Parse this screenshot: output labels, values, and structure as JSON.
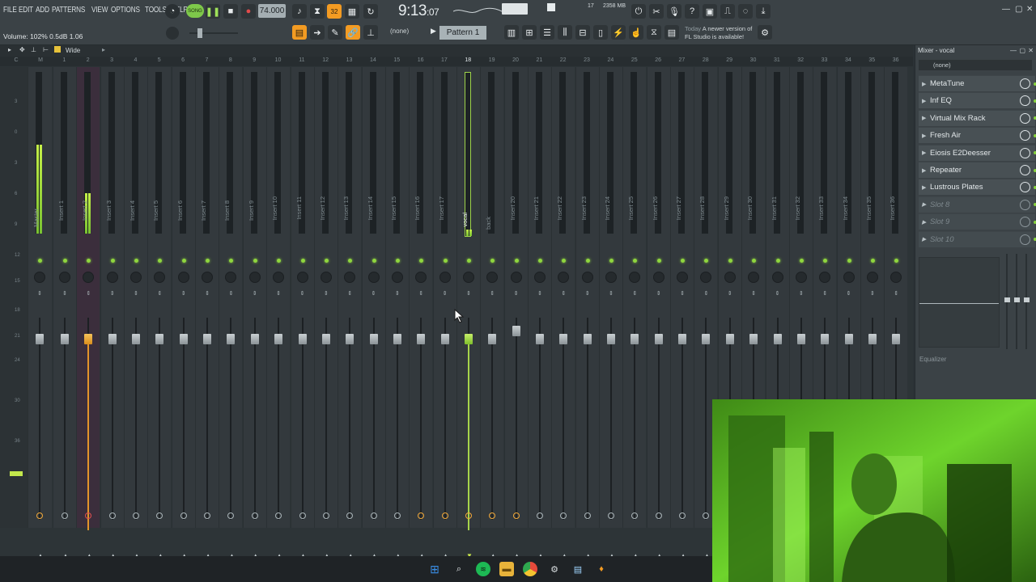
{
  "menu": [
    "FILE",
    "EDIT",
    "ADD",
    "PATTERNS",
    "VIEW",
    "OPTIONS",
    "TOOLS",
    "HELP"
  ],
  "transport": {
    "song_label": "SONG",
    "tempo": "74.000",
    "time": "9:13",
    "time_sub": ":07"
  },
  "hint_bar": "Volume: 102%  0.5dB  1.06",
  "pattern": {
    "selected": "Pattern 1",
    "picker": "(none)"
  },
  "cpu": "17",
  "memory": "2358 MB",
  "news": {
    "day": "Today",
    "line1": "A newer version of",
    "line2": "FL Studio is available!"
  },
  "mixer": {
    "view_label": "Wide",
    "selected_index": 18,
    "strips": [
      {
        "name": "Master",
        "level": 0.55
      },
      {
        "name": "Insert 1",
        "level": 0
      },
      {
        "name": "Insert 2",
        "level": 0.25
      },
      {
        "name": "Insert 3",
        "level": 0
      },
      {
        "name": "Insert 4",
        "level": 0
      },
      {
        "name": "Insert 5",
        "level": 0
      },
      {
        "name": "Insert 6",
        "level": 0
      },
      {
        "name": "Insert 7",
        "level": 0
      },
      {
        "name": "Insert 8",
        "level": 0
      },
      {
        "name": "Insert 9",
        "level": 0
      },
      {
        "name": "Insert 10",
        "level": 0
      },
      {
        "name": "Insert 11",
        "level": 0
      },
      {
        "name": "Insert 12",
        "level": 0
      },
      {
        "name": "Insert 13",
        "level": 0
      },
      {
        "name": "Insert 14",
        "level": 0
      },
      {
        "name": "Insert 15",
        "level": 0
      },
      {
        "name": "Insert 16",
        "level": 0
      },
      {
        "name": "Insert 17",
        "level": 0
      },
      {
        "name": "vocal",
        "level": 0.04
      },
      {
        "name": "back",
        "level": 0
      },
      {
        "name": "Insert 20",
        "level": 0
      },
      {
        "name": "Insert 21",
        "level": 0
      },
      {
        "name": "Insert 22",
        "level": 0
      },
      {
        "name": "Insert 23",
        "level": 0
      },
      {
        "name": "Insert 24",
        "level": 0
      },
      {
        "name": "Insert 25",
        "level": 0
      },
      {
        "name": "Insert 26",
        "level": 0
      },
      {
        "name": "Insert 27",
        "level": 0
      },
      {
        "name": "Insert 28",
        "level": 0
      },
      {
        "name": "Insert 29",
        "level": 0
      },
      {
        "name": "Insert 30",
        "level": 0
      },
      {
        "name": "Insert 31",
        "level": 0
      },
      {
        "name": "Insert 32",
        "level": 0
      },
      {
        "name": "Insert 33",
        "level": 0
      },
      {
        "name": "Insert 34",
        "level": 0
      },
      {
        "name": "Insert 35",
        "level": 0
      },
      {
        "name": "Insert 36",
        "level": 0
      }
    ],
    "ruler_labels": [
      "C",
      "M",
      "1",
      "2",
      "3",
      "4",
      "5",
      "6",
      "7",
      "8",
      "9",
      "10",
      "11",
      "12",
      "13",
      "14",
      "15",
      "16",
      "17",
      "18",
      "19",
      "20",
      "21",
      "22",
      "23",
      "24",
      "25",
      "26",
      "27",
      "28",
      "29",
      "30",
      "31",
      "32",
      "33",
      "34",
      "35",
      "36"
    ]
  },
  "mixer_panel": {
    "title": "Mixer - vocal",
    "input": "(none)",
    "slots": [
      {
        "name": "MetaTune",
        "empty": false
      },
      {
        "name": "Inf EQ",
        "empty": false
      },
      {
        "name": "Virtual Mix Rack",
        "empty": false
      },
      {
        "name": "Fresh Air",
        "empty": false
      },
      {
        "name": "Eiosis E2Deesser",
        "empty": false
      },
      {
        "name": "Repeater",
        "empty": false
      },
      {
        "name": "Lustrous Plates",
        "empty": false
      },
      {
        "name": "Slot 8",
        "empty": true
      },
      {
        "name": "Slot 9",
        "empty": true
      },
      {
        "name": "Slot 10",
        "empty": true
      }
    ],
    "eq_label": "Equalizer"
  },
  "colors": {
    "accent_orange": "#f39b22",
    "level_green": "#8fd63e",
    "selected_strip": "#3b2e3c"
  }
}
